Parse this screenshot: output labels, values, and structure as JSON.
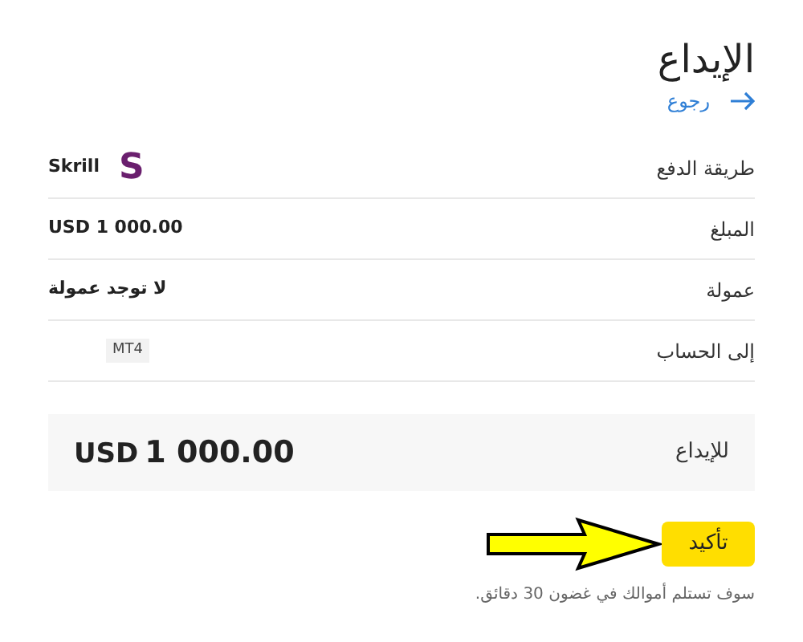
{
  "title": "الإيداع",
  "back_link": "رجوع",
  "details": [
    {
      "label": "طريقة الدفع",
      "value": "Skrill",
      "logo": "S"
    },
    {
      "label": "المبلغ",
      "value": "USD 1 000.00"
    },
    {
      "label": "عمولة",
      "value": "لا توجد عمولة"
    },
    {
      "label": "إلى الحساب",
      "badge": "MT4"
    }
  ],
  "summary": {
    "label": "للإيداع",
    "currency": "USD",
    "amount": "1 000.00"
  },
  "confirm_button": "تأكيد",
  "note": "سوف تستلم أموالك في غضون 30 دقائق."
}
